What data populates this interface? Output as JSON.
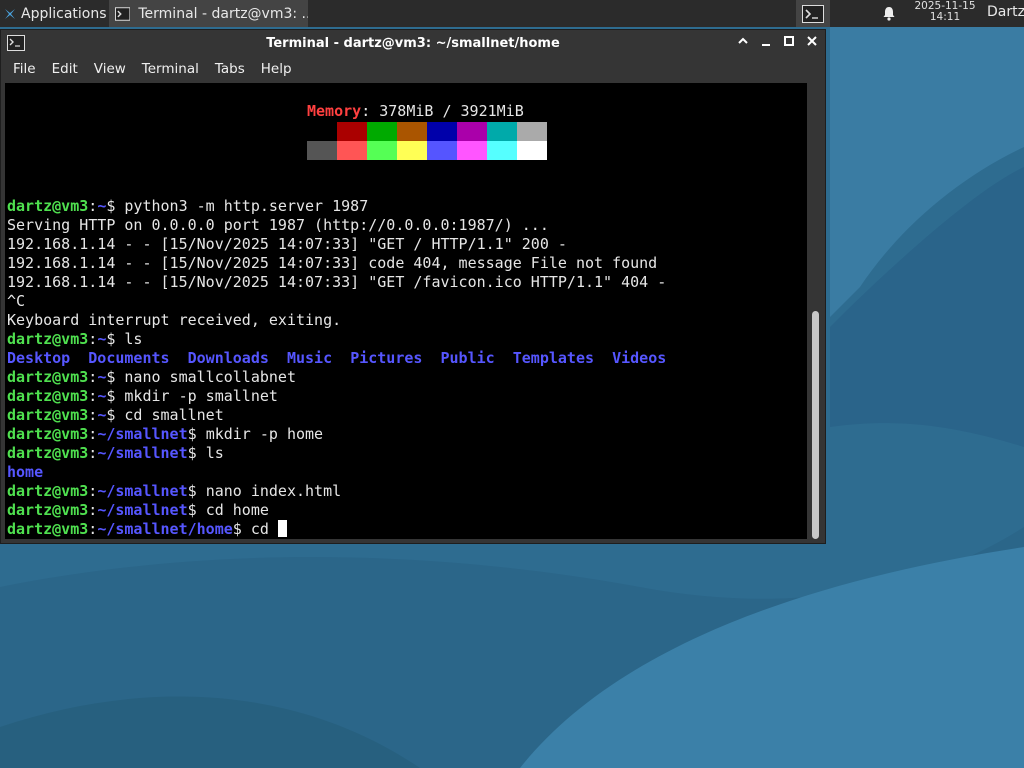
{
  "panel": {
    "applications_label": "Applications",
    "task_label": "Terminal - dartz@vm3: ...",
    "clock_date": "2025-11-15",
    "clock_time": "14:11",
    "user_label": "Dartz"
  },
  "window": {
    "title": "Terminal - dartz@vm3: ~/smallnet/home",
    "menu": [
      "File",
      "Edit",
      "View",
      "Terminal",
      "Tabs",
      "Help"
    ]
  },
  "terminal": {
    "memory_label": "Memory",
    "memory_value": ": 378MiB / 3921MiB",
    "palette_row1": [
      "#000000",
      "#aa0000",
      "#00aa00",
      "#aa5500",
      "#0000aa",
      "#aa00aa",
      "#00aaaa",
      "#aaaaaa"
    ],
    "palette_row2": [
      "#555555",
      "#ff5555",
      "#55ff55",
      "#ffff55",
      "#5555ff",
      "#ff55ff",
      "#55ffff",
      "#ffffff"
    ],
    "prompt_user": "dartz@vm3",
    "lines": {
      "l1_cmd": "python3 -m http.server 1987",
      "l2": "Serving HTTP on 0.0.0.0 port 1987 (http://0.0.0.0:1987/) ...",
      "l3": "192.168.1.14 - - [15/Nov/2025 14:07:33] \"GET / HTTP/1.1\" 200 -",
      "l4": "192.168.1.14 - - [15/Nov/2025 14:07:33] code 404, message File not found",
      "l5": "192.168.1.14 - - [15/Nov/2025 14:07:33] \"GET /favicon.ico HTTP/1.1\" 404 -",
      "l6": "^C",
      "l7": "Keyboard interrupt received, exiting.",
      "l8_cmd": "ls",
      "l9_dirs": [
        "Desktop",
        "Documents",
        "Downloads",
        "Music",
        "Pictures",
        "Public",
        "Templates",
        "Videos"
      ],
      "l10_cmd": "nano smallcollabnet",
      "l11_cmd": "mkdir -p smallnet",
      "l12_cmd": "cd smallnet",
      "l13_cmd": "mkdir -p home",
      "l14_cmd": "ls",
      "l15_dir": "home",
      "l16_cmd": "nano index.html",
      "l17_cmd": "cd home",
      "l18_cmd": "cd "
    },
    "path_home": "~",
    "path_smallnet": "~/smallnet",
    "path_smallnet_home": "~/smallnet/home"
  }
}
